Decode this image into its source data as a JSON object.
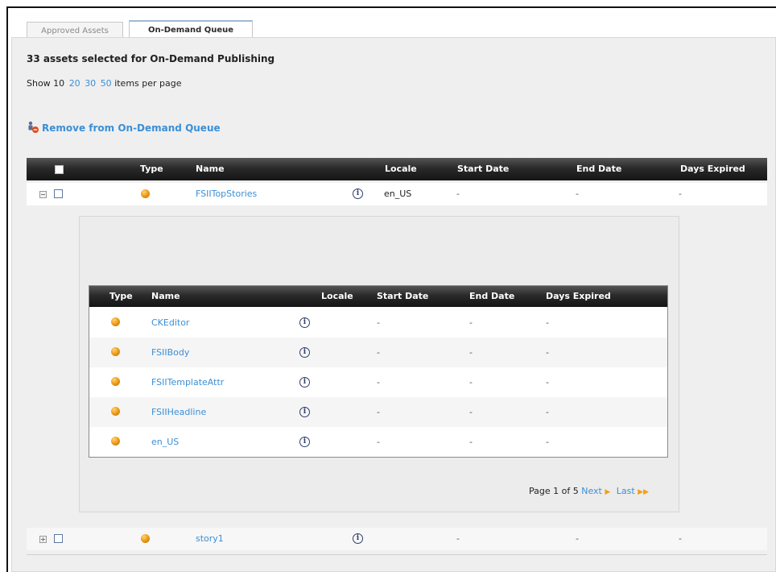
{
  "tabs": [
    {
      "label": "Approved Assets",
      "active": false
    },
    {
      "label": "On-Demand Queue",
      "active": true
    }
  ],
  "selection_summary": "33 assets selected for On-Demand Publishing",
  "per_page": {
    "prefix": "Show 10",
    "options": [
      "20",
      "30",
      "50"
    ],
    "suffix": "items per page"
  },
  "remove_action": {
    "label": "Remove from On-Demand Queue",
    "icon": "remove-person-icon"
  },
  "main_table": {
    "columns": [
      "Type",
      "Name",
      "Locale",
      "Start Date",
      "End Date",
      "Days Expired"
    ],
    "rows": [
      {
        "name": "FSIITopStories",
        "locale": "en_US",
        "start": "-",
        "end": "-",
        "expired": "-",
        "expanded": true
      },
      {
        "name": "story1",
        "locale": "",
        "start": "-",
        "end": "-",
        "expired": "-",
        "expanded": false
      }
    ]
  },
  "inner_table": {
    "columns": [
      "Type",
      "Name",
      "Locale",
      "Start Date",
      "End Date",
      "Days Expired"
    ],
    "rows": [
      {
        "name": "CKEditor",
        "locale": "",
        "start": "-",
        "end": "-",
        "expired": "-"
      },
      {
        "name": "FSIIBody",
        "locale": "",
        "start": "-",
        "end": "-",
        "expired": "-"
      },
      {
        "name": "FSIITemplateAttr",
        "locale": "",
        "start": "-",
        "end": "-",
        "expired": "-"
      },
      {
        "name": "FSIIHeadline",
        "locale": "",
        "start": "-",
        "end": "-",
        "expired": "-"
      },
      {
        "name": "en_US",
        "locale": "",
        "start": "-",
        "end": "-",
        "expired": "-"
      }
    ],
    "pager": {
      "page_text": "Page 1 of 5",
      "next": "Next",
      "last": "Last"
    }
  },
  "colors": {
    "link": "#3b8fd6",
    "header_bg": "#1e1e1e",
    "asset_icon": "#f0a01a"
  }
}
